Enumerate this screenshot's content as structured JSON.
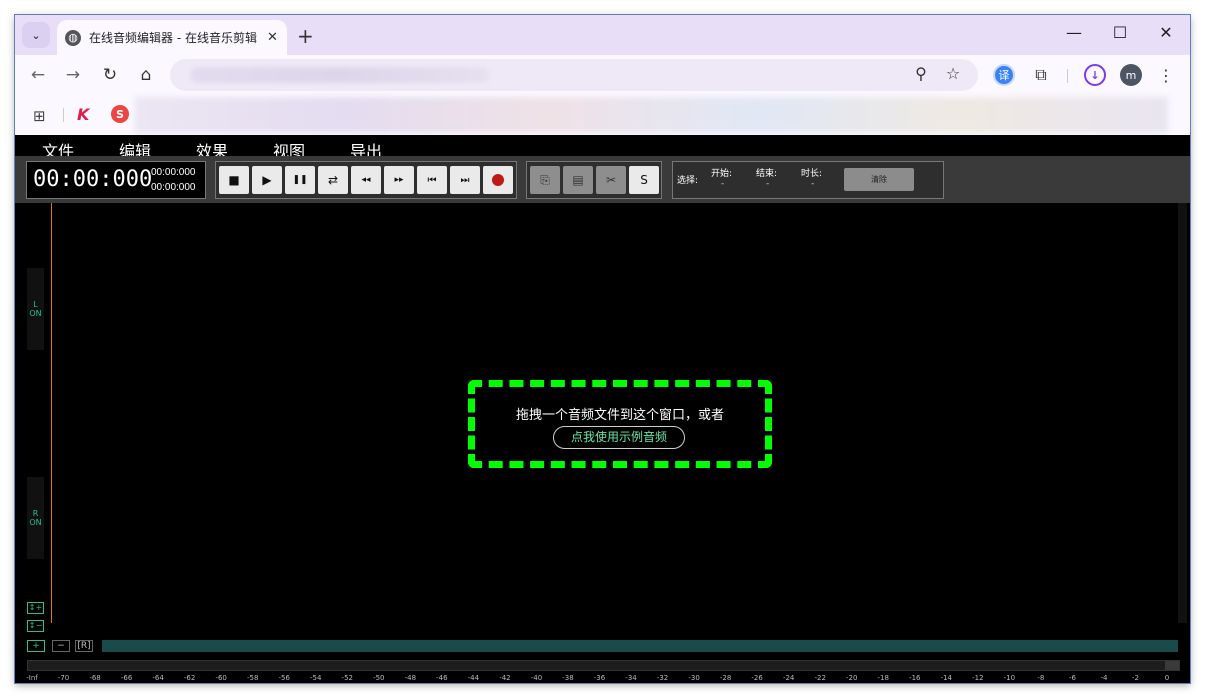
{
  "browser": {
    "tab_title": "在线音频编辑器 - 在线音乐剪辑",
    "tab_close": "✕",
    "new_tab": "+",
    "tab_search": "⌄",
    "window_controls": [
      "—",
      "☐",
      "✕"
    ],
    "nav": {
      "back": "←",
      "forward": "→",
      "reload": "↻",
      "home": "⌂"
    },
    "omnibox_icons": {
      "zoom": "⚲",
      "bookmark": "☆"
    },
    "extensions": {
      "translate": "译",
      "puzzle": "⧉",
      "download": "↓",
      "avatar": "m",
      "menu": "⋮"
    }
  },
  "bookmarks": {
    "apps": "⊞",
    "k_label": "K",
    "s_label": "S"
  },
  "menu": [
    "文件",
    "编辑",
    "效果",
    "视图",
    "导出"
  ],
  "time": {
    "main": "00:00:000",
    "sub1": "00:00:000",
    "sub2": "00:00:000"
  },
  "transport": {
    "stop": "■",
    "play": "▶",
    "pause": "❚❚",
    "loop": "⇄",
    "rewind": "◂◂",
    "forward": "▸▸",
    "to_start": "⏮",
    "to_end": "⏭"
  },
  "edit_buttons": {
    "copy": "⎘",
    "paste": "▤",
    "cut": "✂",
    "silence": "S"
  },
  "selection": {
    "label": "选择:",
    "start_label": "开始:",
    "end_label": "结束:",
    "duration_label": "时长:",
    "start": "-",
    "end": "-",
    "duration": "-",
    "clear": "清除"
  },
  "channels": {
    "left": "L",
    "right": "R",
    "on": "ON"
  },
  "drop": {
    "text": "拖拽一个音频文件到这个窗口，或者",
    "sample": "点我使用示例音频"
  },
  "zoom": {
    "v_plus": "↕+",
    "v_minus": "↕−",
    "h_plus": "+",
    "h_minus": "−",
    "reset": "[R]"
  },
  "meter_scale": [
    "-Inf",
    "-70",
    "-68",
    "-66",
    "-64",
    "-62",
    "-60",
    "-58",
    "-56",
    "-54",
    "-52",
    "-50",
    "-48",
    "-46",
    "-44",
    "-42",
    "-40",
    "-38",
    "-36",
    "-34",
    "-32",
    "-30",
    "-28",
    "-26",
    "-24",
    "-22",
    "-20",
    "-18",
    "-16",
    "-14",
    "-12",
    "-10",
    "-8",
    "-6",
    "-4",
    "-2",
    "0"
  ],
  "colors": {
    "accent_green": "#00ff00",
    "channel_teal": "#2bbf8a",
    "cursor_orange": "#d87a1e",
    "record_red": "#c01818"
  }
}
